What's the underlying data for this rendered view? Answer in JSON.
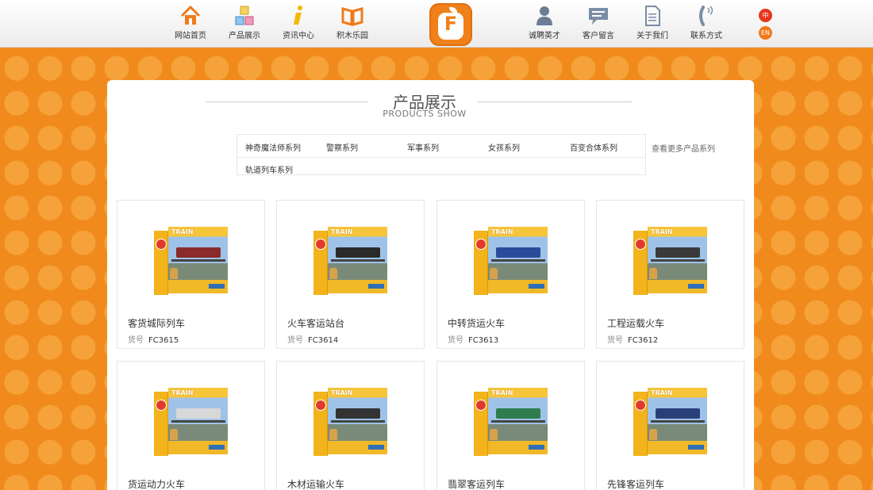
{
  "header": {
    "nav_left": [
      {
        "label": "网站首页",
        "icon": "home-icon"
      },
      {
        "label": "产品展示",
        "icon": "blocks-icon"
      },
      {
        "label": "资讯中心",
        "icon": "info-icon"
      },
      {
        "label": "积木乐园",
        "icon": "book-icon"
      }
    ],
    "logo_letter": "F",
    "nav_right": [
      {
        "label": "诚聘英才",
        "icon": "person-icon"
      },
      {
        "label": "客户留言",
        "icon": "message-icon"
      },
      {
        "label": "关于我们",
        "icon": "document-icon"
      },
      {
        "label": "联系方式",
        "icon": "phone-icon"
      }
    ],
    "lang": {
      "zh": "中",
      "en": "EN"
    }
  },
  "section": {
    "title": "产品展示",
    "subtitle": "PRODUCTS SHOW"
  },
  "categories": [
    "神奇魔法师系列",
    "警察系列",
    "军事系列",
    "女孩系列",
    "百变合体系列",
    "轨道列车系列"
  ],
  "more_link": "查看更多产品系列",
  "code_label": "货号",
  "box_brand": "TRAIN",
  "products": [
    {
      "name": "客货城际列车",
      "code": "FC3615",
      "train_color": "#8b2a2a"
    },
    {
      "name": "火车客运站台",
      "code": "FC3614",
      "train_color": "#2a2a2a"
    },
    {
      "name": "中转货运火车",
      "code": "FC3613",
      "train_color": "#2a4a9a"
    },
    {
      "name": "工程运载火车",
      "code": "FC3612",
      "train_color": "#3a3a3a"
    },
    {
      "name": "货运动力火车",
      "code": "",
      "train_color": "#d8d8d8"
    },
    {
      "name": "木材运输火车",
      "code": "",
      "train_color": "#333333"
    },
    {
      "name": "翡翠客运列车",
      "code": "",
      "train_color": "#2e7d4f"
    },
    {
      "name": "先锋客运列车",
      "code": "",
      "train_color": "#2a3f7a"
    }
  ],
  "colors": {
    "accent": "#f0801a",
    "background": "#f08a1c",
    "lang_zh": "#e8371e"
  }
}
